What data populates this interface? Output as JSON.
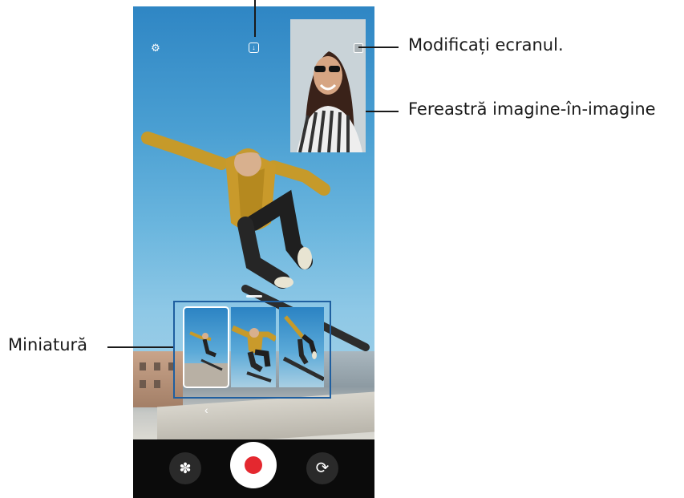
{
  "annotations": {
    "change_screen": "Modificați ecranul.",
    "pip_window": "Fereastră imagine-în-imagine",
    "thumbnail": "Miniatură"
  },
  "camera": {
    "settings_icon": "gear-icon",
    "save_icon": "download-icon",
    "pip_switch_icon": "switch-screen-icon",
    "back_icon": "chevron-left-icon",
    "back_glyph": "‹",
    "filter_icon": "flower-icon",
    "filter_glyph": "✽",
    "record_icon": "record-icon",
    "flip_icon": "camera-flip-icon",
    "flip_glyph": "⟳",
    "thumbnail_count": 3,
    "record_color": "#e4282f",
    "highlight_color": "#1f5fa0"
  }
}
